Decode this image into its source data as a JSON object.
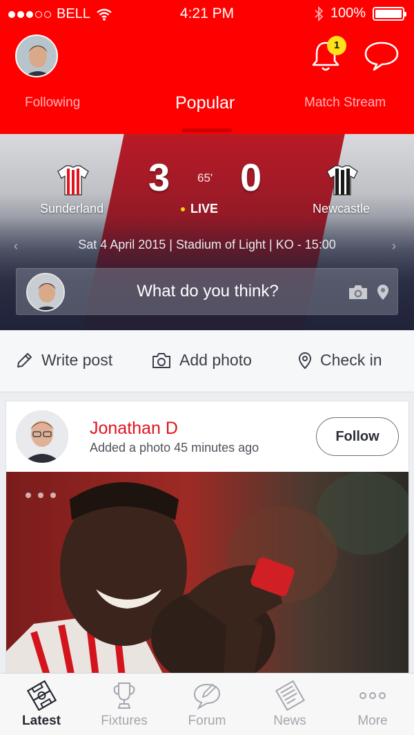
{
  "status_bar": {
    "carrier": "BELL",
    "time": "4:21 PM",
    "battery": "100%"
  },
  "header": {
    "notification_count": "1",
    "tabs": [
      {
        "label": "Following"
      },
      {
        "label": "Popular",
        "active": true
      },
      {
        "label": "Match Stream"
      }
    ],
    "accent_color": "#ff0000"
  },
  "match": {
    "home_team": "Sunderland",
    "away_team": "Newcastle",
    "home_score": "3",
    "away_score": "0",
    "minute": "65'",
    "status": "LIVE",
    "info": "Sat 4 April 2015 | Stadium of Light | KO - 15:00",
    "prev_icon": "‹",
    "next_icon": "›",
    "comment_prompt": "What do you think?"
  },
  "actions": [
    {
      "label": "Write post",
      "icon": "pencil-icon"
    },
    {
      "label": "Add photo",
      "icon": "camera-icon"
    },
    {
      "label": "Check in",
      "icon": "location-pin-icon"
    }
  ],
  "post": {
    "author": "Jonathan D",
    "meta": "Added a photo 45 minutes ago",
    "follow_label": "Follow"
  },
  "tabbar": {
    "items": [
      {
        "label": "Latest",
        "icon": "pitch-icon",
        "active": true
      },
      {
        "label": "Fixtures",
        "icon": "trophy-icon"
      },
      {
        "label": "Forum",
        "icon": "speech-bubble-icon"
      },
      {
        "label": "News",
        "icon": "newspaper-icon"
      },
      {
        "label": "More",
        "icon": "more-dots-icon"
      }
    ]
  }
}
